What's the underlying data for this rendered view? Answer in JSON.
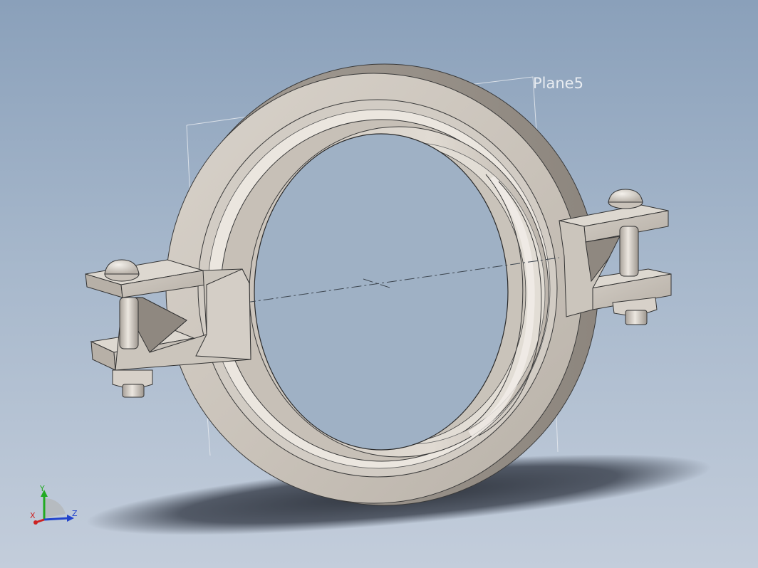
{
  "viewport": {
    "background_top": "#8aa0ba",
    "background_bottom": "#c3cddb",
    "part_color": "#cbc5bd",
    "shadow_color": "#2e3440"
  },
  "model": {
    "reference_plane_label": "Plane5"
  },
  "triad": {
    "x_label": "X",
    "y_label": "Y",
    "z_label": "Z",
    "x_color": "#cc2222",
    "y_color": "#22aa22",
    "z_color": "#2244cc"
  }
}
